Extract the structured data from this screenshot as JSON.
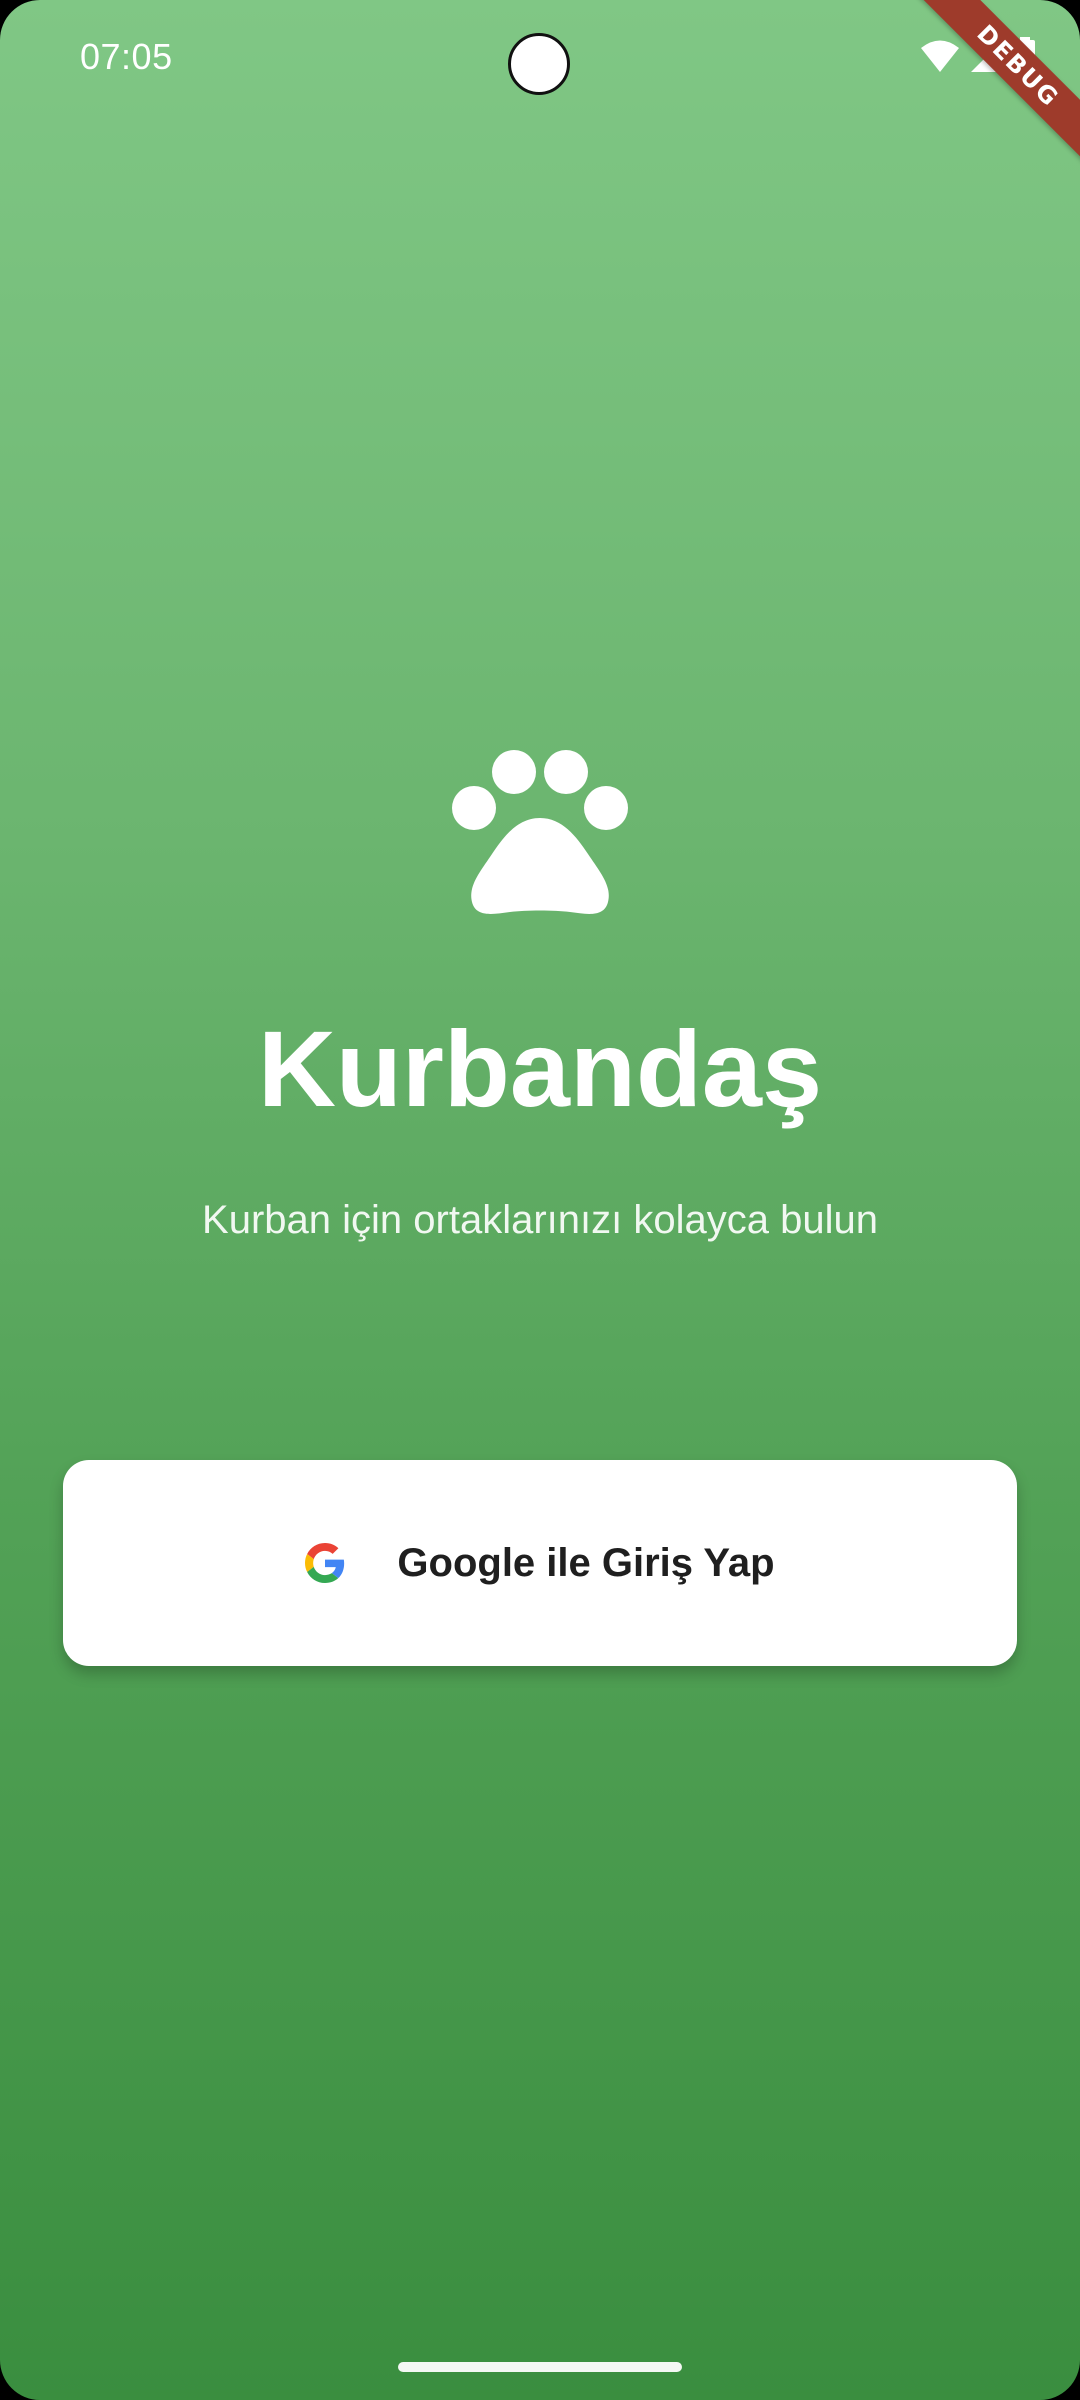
{
  "status_bar": {
    "time": "07:05",
    "icons": [
      "wifi-icon",
      "cellular-signal-icon",
      "battery-icon"
    ]
  },
  "debug_banner": "DEBUG",
  "app": {
    "logo_icon": "paw-icon",
    "title": "Kurbandaş",
    "subtitle": "Kurban için ortaklarınızı kolayca bulun"
  },
  "login": {
    "google_button_label": "Google ile Giriş Yap",
    "google_button_icon": "google-g-icon"
  },
  "colors": {
    "background_top": "#80C785",
    "background_bottom": "#3A8E3F",
    "button_background": "#FFFFFF",
    "button_text": "#1F1F1F",
    "debug_ribbon": "#9E3B2B"
  }
}
